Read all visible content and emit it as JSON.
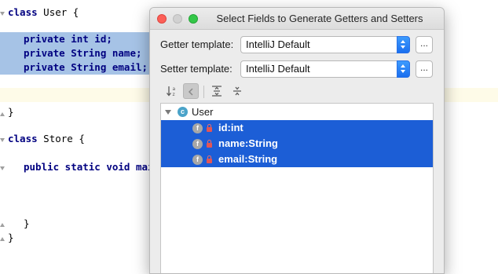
{
  "editor": {
    "lines": [
      {
        "kw": "class",
        "rest": " User {"
      },
      {
        "kw": "",
        "rest": ""
      },
      {
        "kw": "private int id;",
        "rest": ""
      },
      {
        "kw": "private String name;",
        "rest": ""
      },
      {
        "kw": "private String email;",
        "rest": ""
      },
      {
        "kw": "",
        "rest": ""
      },
      {
        "kw": "",
        "rest": ""
      },
      {
        "kw": "}",
        "rest": ""
      },
      {
        "kw": "",
        "rest": ""
      },
      {
        "kw": "class",
        "rest": " Store {"
      },
      {
        "kw": "",
        "rest": ""
      },
      {
        "kw": "public static void main",
        "rest": ""
      },
      {
        "kw": "",
        "rest": ""
      },
      {
        "kw": "",
        "rest": ""
      },
      {
        "kw": "",
        "rest": ""
      },
      {
        "kw": "}",
        "rest": ""
      },
      {
        "kw": "}",
        "rest": ""
      }
    ]
  },
  "dialog": {
    "title": "Select Fields to Generate Getters and Setters",
    "getter_label": "Getter template:",
    "getter_value": "IntelliJ Default",
    "setter_label": "Setter template:",
    "setter_value": "IntelliJ Default",
    "more_label": "...",
    "tree": {
      "root_icon_letter": "c",
      "root_label": "User",
      "fields": [
        {
          "icon_letter": "f",
          "label": "id:int"
        },
        {
          "icon_letter": "f",
          "label": "name:String"
        },
        {
          "icon_letter": "f",
          "label": "email:String"
        }
      ]
    }
  },
  "colors": {
    "selection": "#1c5ed6",
    "editor_selection": "#a6c3e6",
    "keyword": "#000080",
    "close_button": "#fc5f57",
    "zoom_button": "#33c748"
  }
}
